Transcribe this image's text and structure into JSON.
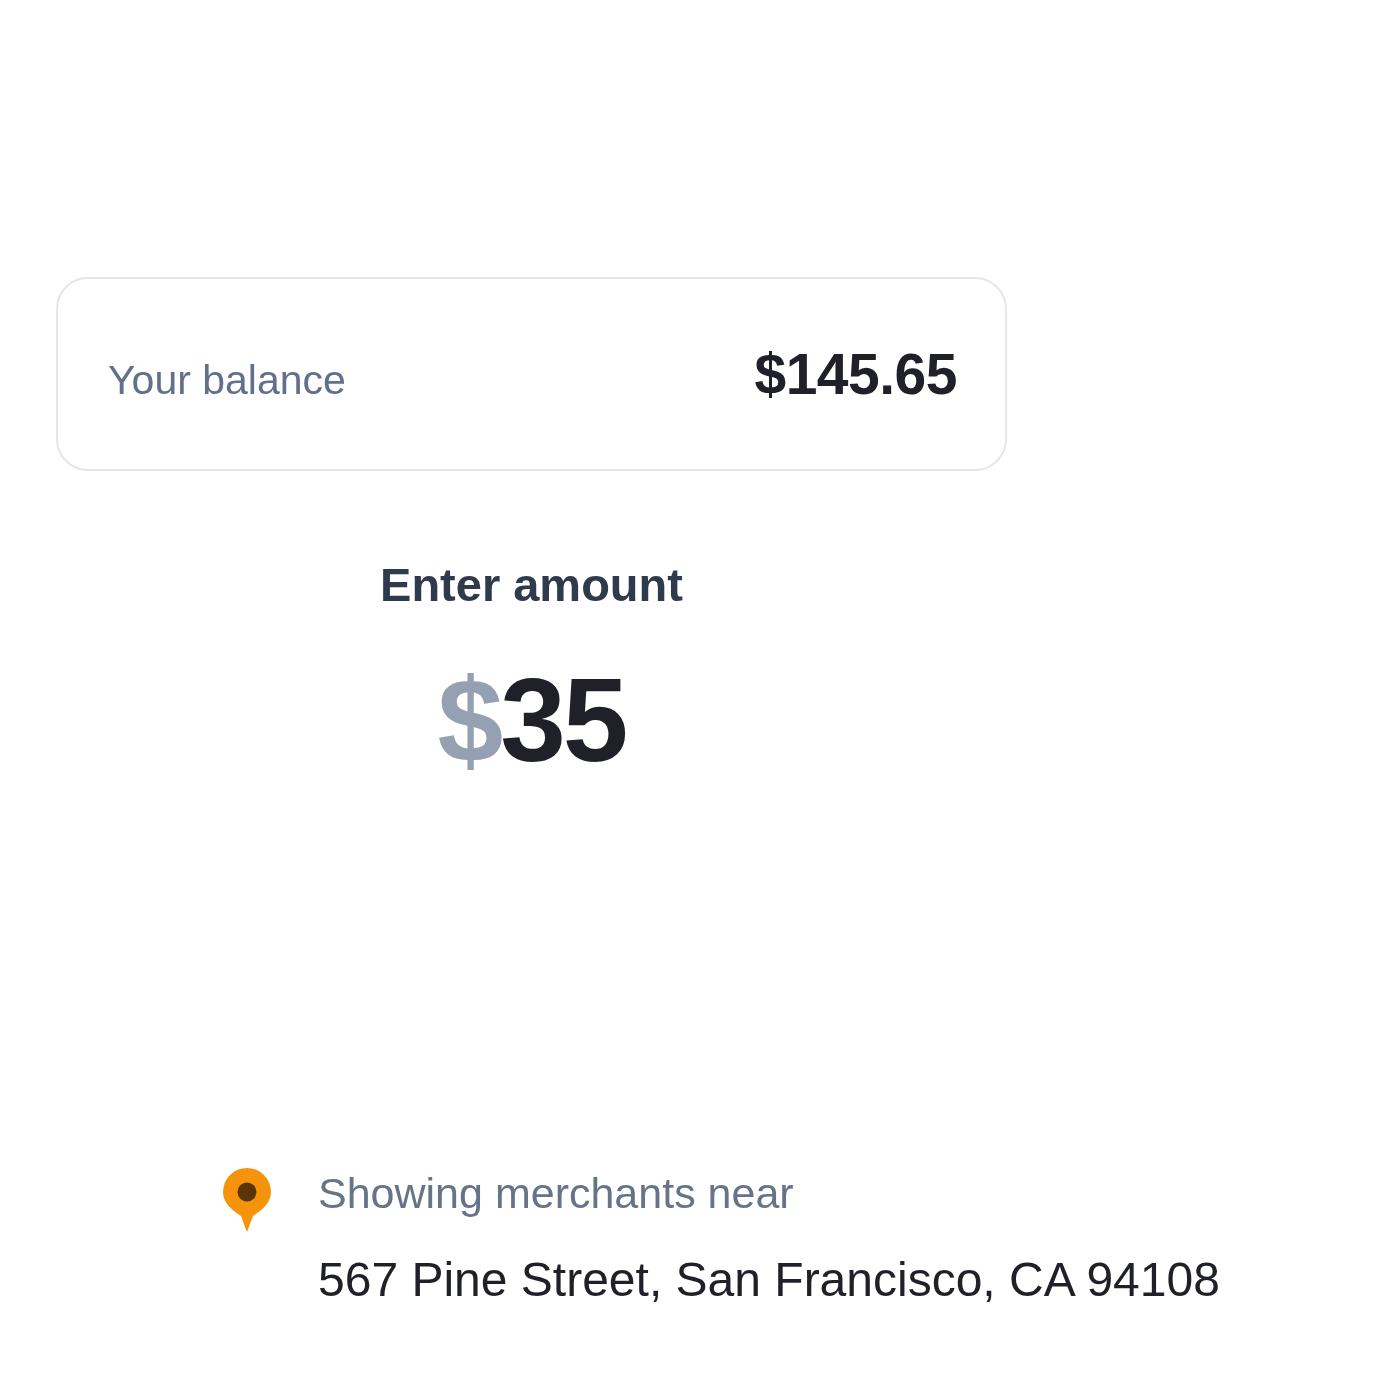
{
  "balance_card": {
    "label": "Your balance",
    "amount": "$145.65"
  },
  "amount_entry": {
    "label": "Enter amount",
    "currency": "$",
    "value": "35"
  },
  "location": {
    "caption": "Showing merchants near",
    "address": "567 Pine Street, San Francisco, CA 94108"
  }
}
